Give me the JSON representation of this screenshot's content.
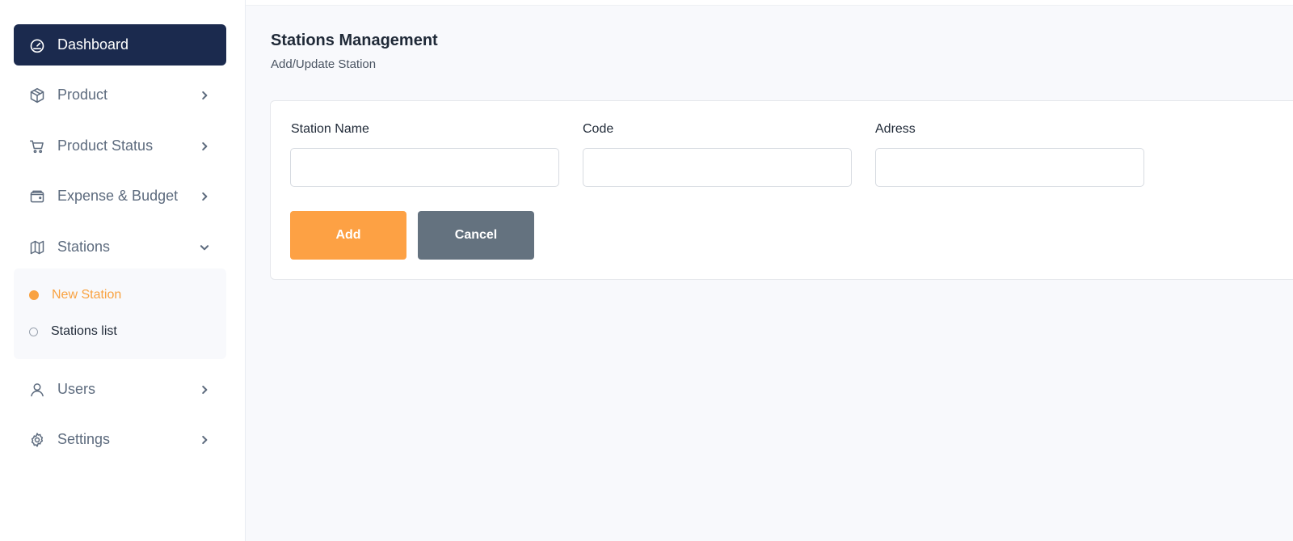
{
  "sidebar": {
    "items": [
      {
        "label": "Dashboard",
        "icon": "gauge-icon",
        "active": true
      },
      {
        "label": "Product",
        "icon": "box-icon",
        "expandable": true
      },
      {
        "label": "Product Status",
        "icon": "cart-icon",
        "expandable": true
      },
      {
        "label": "Expense & Budget",
        "icon": "wallet-icon",
        "expandable": true
      },
      {
        "label": "Stations",
        "icon": "map-icon",
        "expanded": true
      },
      {
        "label": "Users",
        "icon": "user-icon",
        "expandable": true
      },
      {
        "label": "Settings",
        "icon": "gear-icon",
        "expandable": true
      }
    ],
    "stations_submenu": [
      {
        "label": "New Station",
        "active": true
      },
      {
        "label": "Stations list",
        "active": false
      }
    ]
  },
  "page": {
    "title": "Stations Management",
    "subtitle": "Add/Update Station"
  },
  "form": {
    "fields": [
      {
        "label": "Station Name",
        "value": "",
        "placeholder": ""
      },
      {
        "label": "Code",
        "value": "",
        "placeholder": ""
      },
      {
        "label": "Adress",
        "value": "",
        "placeholder": ""
      }
    ],
    "add_label": "Add",
    "cancel_label": "Cancel"
  },
  "colors": {
    "sidebar_active_bg": "#1b2a4e",
    "accent_orange": "#fda144",
    "cancel_gray": "#64727f",
    "text_muted": "#5d6b7e"
  }
}
